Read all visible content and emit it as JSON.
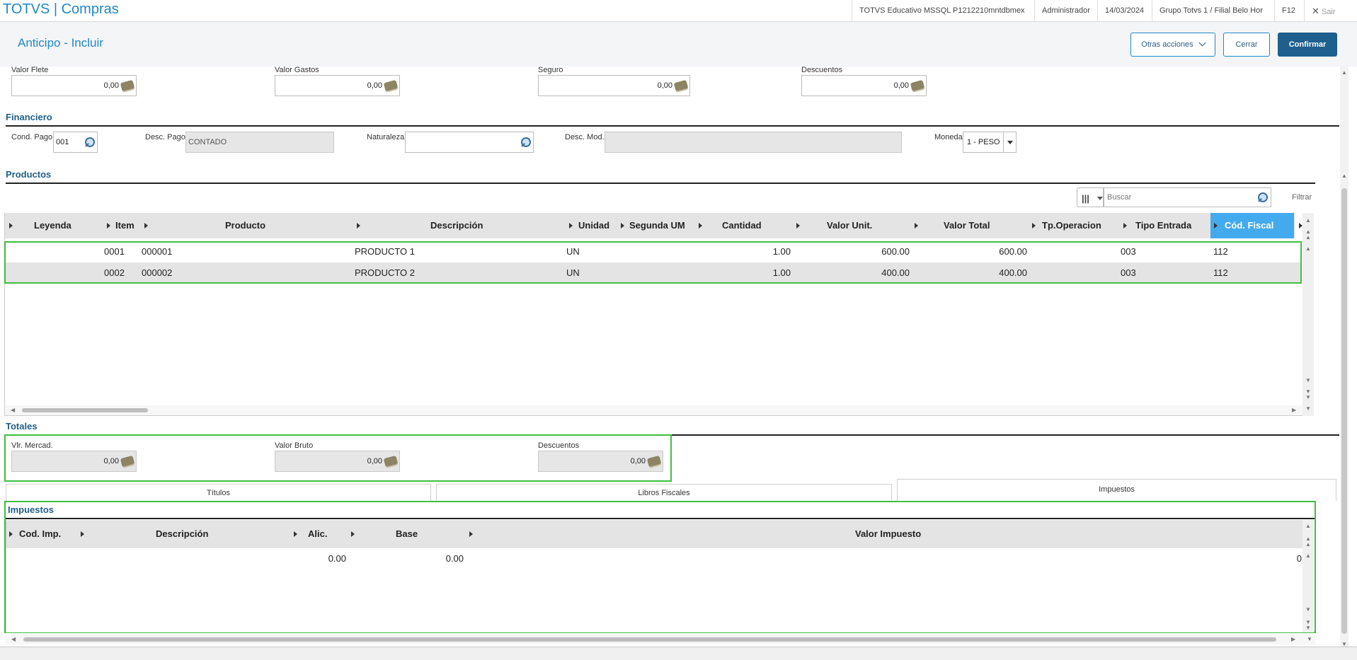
{
  "app": {
    "title": "TOTVS | Compras"
  },
  "topbar": {
    "env": "TOTVS Educativo MSSQL P1212210mntdbmex",
    "user": "Administrador",
    "date": "14/03/2024",
    "branch": "Grupo Totvs 1 / Filial Belo Hor",
    "shortcut": "F12",
    "exit": "Sair"
  },
  "header": {
    "title": "Anticipo - Incluir",
    "other_actions": "Otras acciones",
    "close": "Cerrar",
    "confirm": "Confirmar"
  },
  "freight": {
    "fields": [
      {
        "label": "Valor Flete",
        "value": "0,00"
      },
      {
        "label": "Valor Gastos",
        "value": "0,00"
      },
      {
        "label": "Seguro",
        "value": "0,00"
      },
      {
        "label": "Descuentos",
        "value": "0,00"
      }
    ]
  },
  "financiero": {
    "title": "Financiero",
    "cond_pago_label": "Cond. Pago",
    "cond_pago_value": "001",
    "desc_pago_label": "Desc. Pago",
    "desc_pago_value": "CONTADO",
    "naturaleza_label": "Naturaleza",
    "naturaleza_value": "",
    "desc_mod_label": "Desc. Mod.",
    "desc_mod_value": "",
    "moneda_label": "Moneda",
    "moneda_value": "1 - PESO"
  },
  "productos": {
    "title": "Productos",
    "search_placeholder": "Buscar",
    "filter": "Filtrar",
    "columns": [
      "Leyenda",
      "Item",
      "Producto",
      "Descripción",
      "Unidad",
      "Segunda UM",
      "Cantidad",
      "Valor Unit.",
      "Valor Total",
      "Tp.Operacion",
      "Tipo Entrada",
      "Cód. Fiscal"
    ],
    "rows": [
      {
        "item": "0001",
        "producto": "000001",
        "descripcion": "PRODUCTO 1",
        "unidad": "UN",
        "cantidad": "1.00",
        "valor_unit": "600.00",
        "valor_total": "600.00",
        "tipo_entrada": "003",
        "cod_fiscal": "112"
      },
      {
        "item": "0002",
        "producto": "000002",
        "descripcion": "PRODUCTO 2",
        "unidad": "UN",
        "cantidad": "1.00",
        "valor_unit": "400.00",
        "valor_total": "400.00",
        "tipo_entrada": "003",
        "cod_fiscal": "112"
      }
    ]
  },
  "totales": {
    "title": "Totales",
    "fields": [
      {
        "label": "Vlr. Mercad.",
        "value": "0,00"
      },
      {
        "label": "Valor Bruto",
        "value": "0,00"
      },
      {
        "label": "Descuentos",
        "value": "0,00"
      }
    ]
  },
  "tabs": [
    "Títulos",
    "Libros Fiscales",
    "Impuestos"
  ],
  "impuestos": {
    "title": "Impuestos",
    "columns": [
      "Cod. Imp.",
      "Descripción",
      "Alic.",
      "Base",
      "Valor Impuesto"
    ],
    "rows": [
      {
        "cod": "",
        "descripcion": "",
        "alic": "0.00",
        "base": "0.00",
        "valor": "0"
      }
    ]
  },
  "colors": {
    "accent": "#1e88c9",
    "primary_button": "#1e5f8e",
    "highlight": "#3fbf3f",
    "selected_header": "#44aaee"
  }
}
